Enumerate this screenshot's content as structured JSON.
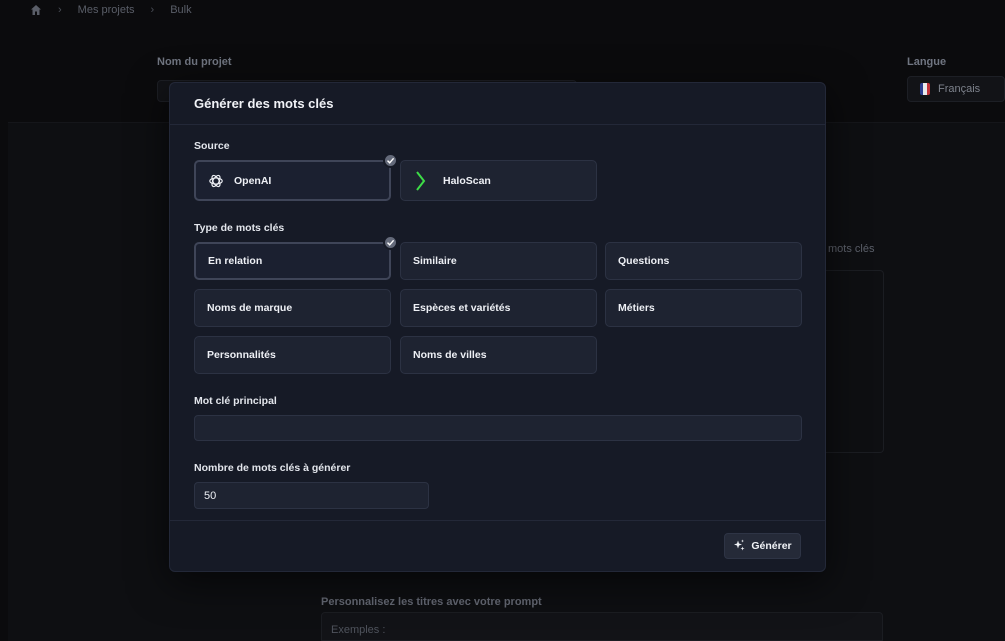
{
  "breadcrumb": {
    "items": [
      "Mes projets",
      "Bulk"
    ]
  },
  "background": {
    "project_name_label": "Nom du projet",
    "language_label": "Langue",
    "language_value": "Français",
    "right_hint": "mots clés",
    "prompt_label": "Personnalisez les titres avec votre prompt",
    "prompt_placeholder": "Exemples :"
  },
  "modal": {
    "title": "Générer des mots clés",
    "source_label": "Source",
    "sources": [
      {
        "label": "OpenAI",
        "icon": "openai-icon",
        "selected": true
      },
      {
        "label": "HaloScan",
        "icon": "haloscan-icon",
        "selected": false
      }
    ],
    "type_label": "Type de mots clés",
    "types": [
      {
        "label": "En relation",
        "selected": true
      },
      {
        "label": "Similaire",
        "selected": false
      },
      {
        "label": "Questions",
        "selected": false
      },
      {
        "label": "Noms de marque",
        "selected": false
      },
      {
        "label": "Espèces et variétés",
        "selected": false
      },
      {
        "label": "Métiers",
        "selected": false
      },
      {
        "label": "Personnalités",
        "selected": false
      },
      {
        "label": "Noms de villes",
        "selected": false
      }
    ],
    "main_keyword_label": "Mot clé principal",
    "main_keyword_value": "",
    "count_label": "Nombre de mots clés à générer",
    "count_value": "50",
    "generate_label": "Générer"
  },
  "colors": {
    "accent_green": "#3ddc47",
    "check_badge": "#646a7a"
  }
}
